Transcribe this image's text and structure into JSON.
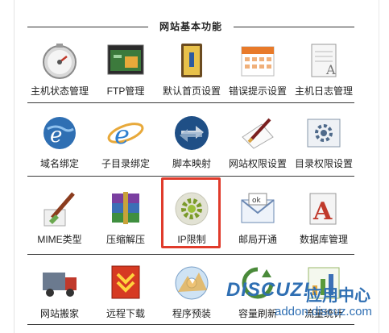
{
  "section": {
    "title": "网站基本功能"
  },
  "rows": [
    [
      {
        "label": "主机状态管理",
        "icon": "gauge-icon"
      },
      {
        "label": "FTP管理",
        "icon": "ftp-window-icon"
      },
      {
        "label": "默认首页设置",
        "icon": "binder-icon"
      },
      {
        "label": "错误提示设置",
        "icon": "calendar-icon"
      },
      {
        "label": "主机日志管理",
        "icon": "document-icon"
      }
    ],
    [
      {
        "label": "域名绑定",
        "icon": "globe-ie-icon"
      },
      {
        "label": "子目录绑定",
        "icon": "ie-icon"
      },
      {
        "label": "脚本映射",
        "icon": "sync-arrows-icon"
      },
      {
        "label": "网站权限设置",
        "icon": "pen-paper-icon"
      },
      {
        "label": "目录权限设置",
        "icon": "gear-window-icon"
      }
    ],
    [
      {
        "label": "MIME类型",
        "icon": "brush-icon"
      },
      {
        "label": "压缩解压",
        "icon": "archive-icon"
      },
      {
        "label": "IP限制",
        "icon": "gear-circle-icon",
        "selected": true
      },
      {
        "label": "邮局开通",
        "icon": "mail-icon"
      },
      {
        "label": "数据库管理",
        "icon": "database-icon"
      }
    ],
    [
      {
        "label": "网站搬家",
        "icon": "truck-icon"
      },
      {
        "label": "远程下载",
        "icon": "download-icon"
      },
      {
        "label": "程序预装",
        "icon": "cd-icon"
      },
      {
        "label": "容量刷新",
        "icon": "refresh-icon"
      },
      {
        "label": "流量统计",
        "icon": "chart-icon"
      }
    ]
  ],
  "watermark": {
    "brand": "DISCUZ!",
    "brand_suffix": "应用中心",
    "site": "addon.discuz.com"
  },
  "colors": {
    "highlight": "#e03b2b",
    "watermark": "#2f6fb3"
  }
}
